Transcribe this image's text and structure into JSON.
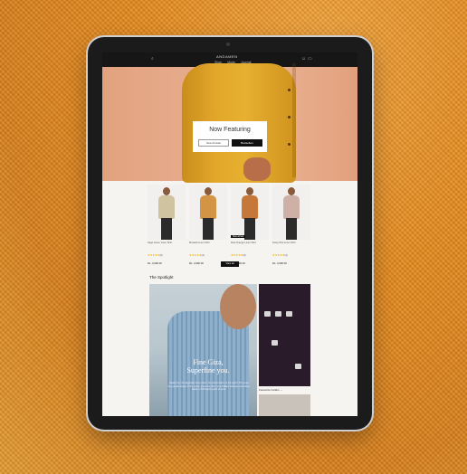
{
  "browser": {
    "logo": "ANDAMEN",
    "nav": [
      "Shop",
      "Mode",
      "Journal"
    ]
  },
  "hero": {
    "title": "Now Featuring",
    "button_secondary": "New Arrivals",
    "button_primary": "Bestsellers"
  },
  "products": [
    {
      "name": "Sage Green Linen Shirt",
      "stars": "★★★★★",
      "rating": "(6)",
      "price": "Rs. 3,990.00",
      "badge": "",
      "color": "#cfc3a0"
    },
    {
      "name": "Mustard Linen Shirt",
      "stars": "★★★★★",
      "rating": "(4)",
      "price": "Rs. 3,990.00",
      "badge": "",
      "color": "#d39446"
    },
    {
      "name": "Rust Orange Linen Shirt",
      "stars": "★★★★★",
      "rating": "(5)",
      "price": "Rs. 3,990.00",
      "badge": "New arrival",
      "color": "#c5783a"
    },
    {
      "name": "Dusty Pink Linen Shirt",
      "stars": "★★★★★",
      "rating": "(3)",
      "price": "Rs. 3,990.00",
      "badge": "",
      "color": "#cdb0a6"
    }
  ],
  "view_all": "View all",
  "spotlight": {
    "heading": "The Spotlight",
    "feature_title_1": "Fine Giza,",
    "feature_title_2": "Superfine you.",
    "feature_text": "Made from the Egyptian Giza cotton, the finest cotton in the world. The extra long staple length of the cotton gives the shirt more brilliant softness and shine. Made to withstand years of wear.",
    "side_label": "Favourite Collars →"
  },
  "colors": {
    "background": "#e68a1c",
    "tablet": "#1b1b1b",
    "accent": "#111111"
  }
}
